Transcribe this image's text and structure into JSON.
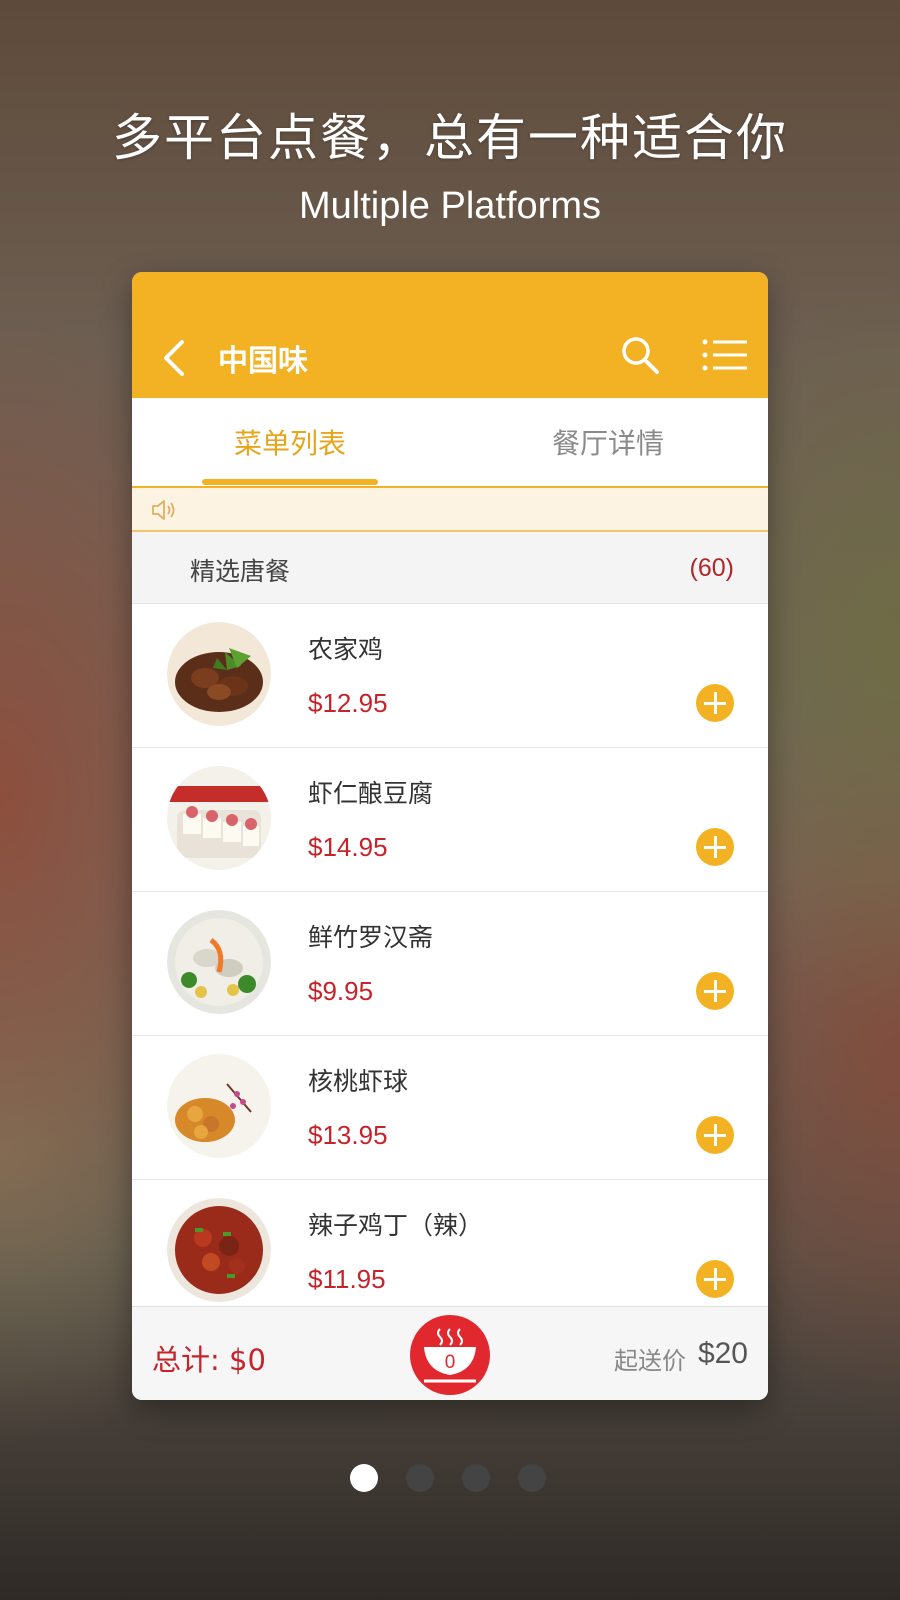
{
  "promo": {
    "headline": "多平台点餐，总有一种适合你",
    "subline": "Multiple Platforms"
  },
  "app": {
    "title": "中国味",
    "accent_color": "#f3b223",
    "price_color": "#c4242a",
    "icons": [
      "back-icon",
      "search-icon",
      "menu-icon",
      "speaker-icon",
      "bowl-icon"
    ]
  },
  "tabs": [
    {
      "label": "菜单列表",
      "active": true
    },
    {
      "label": "餐厅详情",
      "active": false
    }
  ],
  "category": {
    "name": "精选唐餐",
    "count": "(60)"
  },
  "dishes": [
    {
      "name": "农家鸡",
      "price": "$12.95"
    },
    {
      "name": "虾仁酿豆腐",
      "price": "$14.95"
    },
    {
      "name": "鲜竹罗汉斋",
      "price": "$9.95"
    },
    {
      "name": "核桃虾球",
      "price": "$13.95"
    },
    {
      "name": "辣子鸡丁（辣）",
      "price": "$11.95"
    }
  ],
  "cart": {
    "total_label": "总计: $0",
    "count": "0",
    "min_order_label": "起送价",
    "min_order_value": "$20"
  },
  "pager": {
    "pages": 4,
    "active_index": 0
  }
}
